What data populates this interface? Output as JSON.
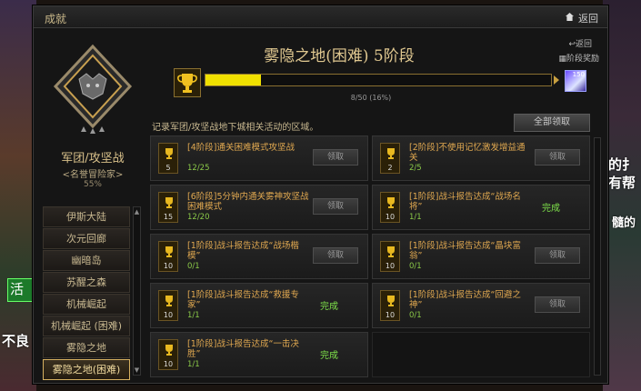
{
  "window": {
    "title": "成就",
    "return_label": "返回"
  },
  "category": {
    "title": "军团/攻坚战",
    "subtitle": "<名誉冒险家>",
    "percent": "55%"
  },
  "categories": [
    "伊斯大陆",
    "次元回廊",
    "幽暗岛",
    "苏醒之森",
    "机械崛起",
    "机械崛起 (困难)",
    "雾隐之地",
    "雾隐之地(困难)"
  ],
  "active_category_index": 7,
  "stage": {
    "title": "雾隐之地(困难) 5阶段",
    "back": "返回",
    "reward": "阶段奖励",
    "progress_text": "8/50 (16%)",
    "progress_fraction": 0.16,
    "reward_count": "150",
    "description": "记录军团/攻坚战地下城相关活动的区域。",
    "claim_all": "全部领取"
  },
  "cards": [
    {
      "num": "5",
      "name": "[4阶段]通关困难模式攻坚战",
      "progress": "12/25",
      "status": "领取"
    },
    {
      "num": "2",
      "name": "[2阶段]不使用记忆激发增益通关",
      "progress": "2/5",
      "status": "领取"
    },
    {
      "num": "15",
      "name": "[6阶段]5分钟内通关雾神攻坚战困难模式",
      "progress": "12/20",
      "status": "领取"
    },
    {
      "num": "10",
      "name": "[1阶段]战斗报告达成“战场名将”",
      "progress": "1/1",
      "status": "完成"
    },
    {
      "num": "10",
      "name": "[1阶段]战斗报告达成“战场楷模”",
      "progress": "0/1",
      "status": "领取"
    },
    {
      "num": "10",
      "name": "[1阶段]战斗报告达成“晶块富翁”",
      "progress": "0/1",
      "status": "领取"
    },
    {
      "num": "10",
      "name": "[1阶段]战斗报告达成“救援专家”",
      "progress": "1/1",
      "status": "完成"
    },
    {
      "num": "10",
      "name": "[1阶段]战斗报告达成“回避之神”",
      "progress": "0/1",
      "status": "领取"
    },
    {
      "num": "10",
      "name": "[1阶段]战斗报告达成“一击决胜”",
      "progress": "1/1",
      "status": "完成"
    }
  ],
  "background": {
    "t1": "的扌",
    "t2": "有帮",
    "t3": "髓的",
    "t4": "活",
    "t5": "不良"
  }
}
